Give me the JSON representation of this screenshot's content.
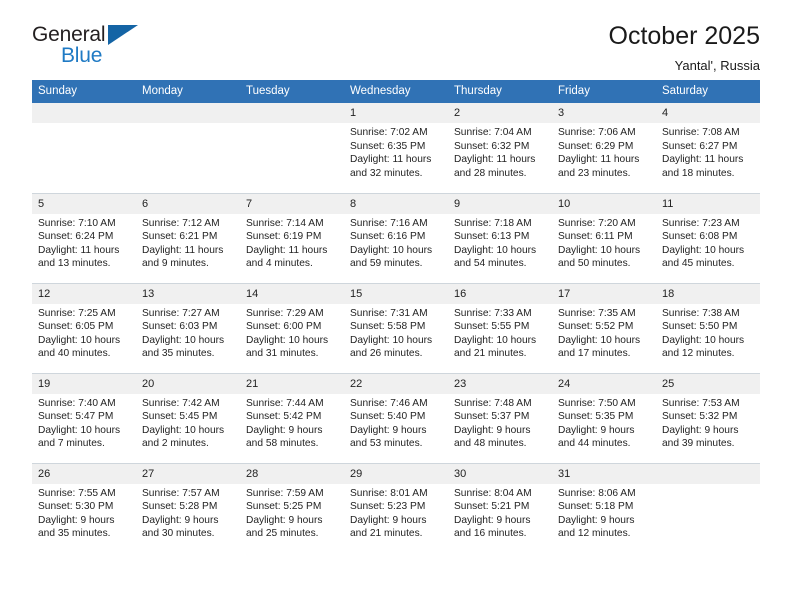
{
  "logo": {
    "word_one": "General",
    "word_two": "Blue",
    "accent_dark": "#1464a5",
    "accent_blue": "#1f7ac4"
  },
  "header": {
    "title": "October 2025",
    "subtitle": "Yantal', Russia",
    "header_bg": "#3072b5",
    "header_text": "#ffffff"
  },
  "weekdays": [
    "Sunday",
    "Monday",
    "Tuesday",
    "Wednesday",
    "Thursday",
    "Friday",
    "Saturday"
  ],
  "weeks": [
    [
      {
        "day": "",
        "sunrise": "",
        "sunset": "",
        "daylight_line1": "",
        "daylight_line2": "",
        "empty": true
      },
      {
        "day": "",
        "sunrise": "",
        "sunset": "",
        "daylight_line1": "",
        "daylight_line2": "",
        "empty": true
      },
      {
        "day": "",
        "sunrise": "",
        "sunset": "",
        "daylight_line1": "",
        "daylight_line2": "",
        "empty": true
      },
      {
        "day": "1",
        "sunrise": "Sunrise: 7:02 AM",
        "sunset": "Sunset: 6:35 PM",
        "daylight_line1": "Daylight: 11 hours",
        "daylight_line2": "and 32 minutes.",
        "empty": false
      },
      {
        "day": "2",
        "sunrise": "Sunrise: 7:04 AM",
        "sunset": "Sunset: 6:32 PM",
        "daylight_line1": "Daylight: 11 hours",
        "daylight_line2": "and 28 minutes.",
        "empty": false
      },
      {
        "day": "3",
        "sunrise": "Sunrise: 7:06 AM",
        "sunset": "Sunset: 6:29 PM",
        "daylight_line1": "Daylight: 11 hours",
        "daylight_line2": "and 23 minutes.",
        "empty": false
      },
      {
        "day": "4",
        "sunrise": "Sunrise: 7:08 AM",
        "sunset": "Sunset: 6:27 PM",
        "daylight_line1": "Daylight: 11 hours",
        "daylight_line2": "and 18 minutes.",
        "empty": false
      }
    ],
    [
      {
        "day": "5",
        "sunrise": "Sunrise: 7:10 AM",
        "sunset": "Sunset: 6:24 PM",
        "daylight_line1": "Daylight: 11 hours",
        "daylight_line2": "and 13 minutes.",
        "empty": false
      },
      {
        "day": "6",
        "sunrise": "Sunrise: 7:12 AM",
        "sunset": "Sunset: 6:21 PM",
        "daylight_line1": "Daylight: 11 hours",
        "daylight_line2": "and 9 minutes.",
        "empty": false
      },
      {
        "day": "7",
        "sunrise": "Sunrise: 7:14 AM",
        "sunset": "Sunset: 6:19 PM",
        "daylight_line1": "Daylight: 11 hours",
        "daylight_line2": "and 4 minutes.",
        "empty": false
      },
      {
        "day": "8",
        "sunrise": "Sunrise: 7:16 AM",
        "sunset": "Sunset: 6:16 PM",
        "daylight_line1": "Daylight: 10 hours",
        "daylight_line2": "and 59 minutes.",
        "empty": false
      },
      {
        "day": "9",
        "sunrise": "Sunrise: 7:18 AM",
        "sunset": "Sunset: 6:13 PM",
        "daylight_line1": "Daylight: 10 hours",
        "daylight_line2": "and 54 minutes.",
        "empty": false
      },
      {
        "day": "10",
        "sunrise": "Sunrise: 7:20 AM",
        "sunset": "Sunset: 6:11 PM",
        "daylight_line1": "Daylight: 10 hours",
        "daylight_line2": "and 50 minutes.",
        "empty": false
      },
      {
        "day": "11",
        "sunrise": "Sunrise: 7:23 AM",
        "sunset": "Sunset: 6:08 PM",
        "daylight_line1": "Daylight: 10 hours",
        "daylight_line2": "and 45 minutes.",
        "empty": false
      }
    ],
    [
      {
        "day": "12",
        "sunrise": "Sunrise: 7:25 AM",
        "sunset": "Sunset: 6:05 PM",
        "daylight_line1": "Daylight: 10 hours",
        "daylight_line2": "and 40 minutes.",
        "empty": false
      },
      {
        "day": "13",
        "sunrise": "Sunrise: 7:27 AM",
        "sunset": "Sunset: 6:03 PM",
        "daylight_line1": "Daylight: 10 hours",
        "daylight_line2": "and 35 minutes.",
        "empty": false
      },
      {
        "day": "14",
        "sunrise": "Sunrise: 7:29 AM",
        "sunset": "Sunset: 6:00 PM",
        "daylight_line1": "Daylight: 10 hours",
        "daylight_line2": "and 31 minutes.",
        "empty": false
      },
      {
        "day": "15",
        "sunrise": "Sunrise: 7:31 AM",
        "sunset": "Sunset: 5:58 PM",
        "daylight_line1": "Daylight: 10 hours",
        "daylight_line2": "and 26 minutes.",
        "empty": false
      },
      {
        "day": "16",
        "sunrise": "Sunrise: 7:33 AM",
        "sunset": "Sunset: 5:55 PM",
        "daylight_line1": "Daylight: 10 hours",
        "daylight_line2": "and 21 minutes.",
        "empty": false
      },
      {
        "day": "17",
        "sunrise": "Sunrise: 7:35 AM",
        "sunset": "Sunset: 5:52 PM",
        "daylight_line1": "Daylight: 10 hours",
        "daylight_line2": "and 17 minutes.",
        "empty": false
      },
      {
        "day": "18",
        "sunrise": "Sunrise: 7:38 AM",
        "sunset": "Sunset: 5:50 PM",
        "daylight_line1": "Daylight: 10 hours",
        "daylight_line2": "and 12 minutes.",
        "empty": false
      }
    ],
    [
      {
        "day": "19",
        "sunrise": "Sunrise: 7:40 AM",
        "sunset": "Sunset: 5:47 PM",
        "daylight_line1": "Daylight: 10 hours",
        "daylight_line2": "and 7 minutes.",
        "empty": false
      },
      {
        "day": "20",
        "sunrise": "Sunrise: 7:42 AM",
        "sunset": "Sunset: 5:45 PM",
        "daylight_line1": "Daylight: 10 hours",
        "daylight_line2": "and 2 minutes.",
        "empty": false
      },
      {
        "day": "21",
        "sunrise": "Sunrise: 7:44 AM",
        "sunset": "Sunset: 5:42 PM",
        "daylight_line1": "Daylight: 9 hours",
        "daylight_line2": "and 58 minutes.",
        "empty": false
      },
      {
        "day": "22",
        "sunrise": "Sunrise: 7:46 AM",
        "sunset": "Sunset: 5:40 PM",
        "daylight_line1": "Daylight: 9 hours",
        "daylight_line2": "and 53 minutes.",
        "empty": false
      },
      {
        "day": "23",
        "sunrise": "Sunrise: 7:48 AM",
        "sunset": "Sunset: 5:37 PM",
        "daylight_line1": "Daylight: 9 hours",
        "daylight_line2": "and 48 minutes.",
        "empty": false
      },
      {
        "day": "24",
        "sunrise": "Sunrise: 7:50 AM",
        "sunset": "Sunset: 5:35 PM",
        "daylight_line1": "Daylight: 9 hours",
        "daylight_line2": "and 44 minutes.",
        "empty": false
      },
      {
        "day": "25",
        "sunrise": "Sunrise: 7:53 AM",
        "sunset": "Sunset: 5:32 PM",
        "daylight_line1": "Daylight: 9 hours",
        "daylight_line2": "and 39 minutes.",
        "empty": false
      }
    ],
    [
      {
        "day": "26",
        "sunrise": "Sunrise: 7:55 AM",
        "sunset": "Sunset: 5:30 PM",
        "daylight_line1": "Daylight: 9 hours",
        "daylight_line2": "and 35 minutes.",
        "empty": false
      },
      {
        "day": "27",
        "sunrise": "Sunrise: 7:57 AM",
        "sunset": "Sunset: 5:28 PM",
        "daylight_line1": "Daylight: 9 hours",
        "daylight_line2": "and 30 minutes.",
        "empty": false
      },
      {
        "day": "28",
        "sunrise": "Sunrise: 7:59 AM",
        "sunset": "Sunset: 5:25 PM",
        "daylight_line1": "Daylight: 9 hours",
        "daylight_line2": "and 25 minutes.",
        "empty": false
      },
      {
        "day": "29",
        "sunrise": "Sunrise: 8:01 AM",
        "sunset": "Sunset: 5:23 PM",
        "daylight_line1": "Daylight: 9 hours",
        "daylight_line2": "and 21 minutes.",
        "empty": false
      },
      {
        "day": "30",
        "sunrise": "Sunrise: 8:04 AM",
        "sunset": "Sunset: 5:21 PM",
        "daylight_line1": "Daylight: 9 hours",
        "daylight_line2": "and 16 minutes.",
        "empty": false
      },
      {
        "day": "31",
        "sunrise": "Sunrise: 8:06 AM",
        "sunset": "Sunset: 5:18 PM",
        "daylight_line1": "Daylight: 9 hours",
        "daylight_line2": "and 12 minutes.",
        "empty": false
      },
      {
        "day": "",
        "sunrise": "",
        "sunset": "",
        "daylight_line1": "",
        "daylight_line2": "",
        "empty": true
      }
    ]
  ]
}
